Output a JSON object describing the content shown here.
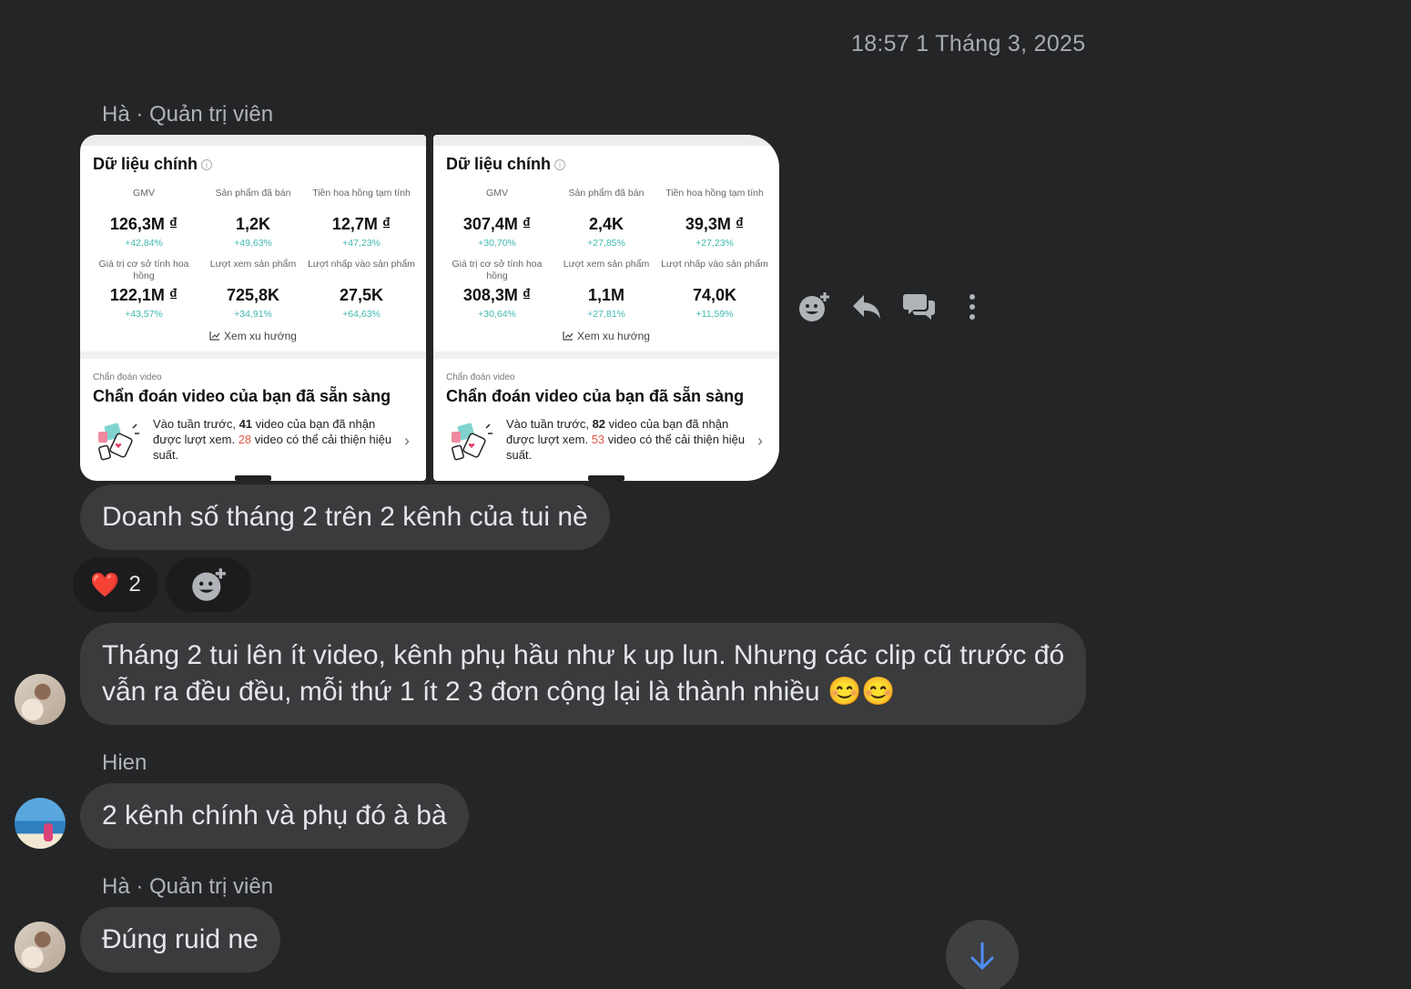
{
  "timestamp": "18:57 1 Tháng 3, 2025",
  "senders": {
    "ha_admin_1": "Hà · Quản trị viên",
    "hien": "Hien",
    "ha_admin_2": "Hà · Quản trị viên"
  },
  "cards": [
    {
      "title": "Dữ liệu chính",
      "metrics": [
        {
          "label": "GMV",
          "value": "126,3M ₫",
          "change": "+42,84%"
        },
        {
          "label": "Sản phẩm đã bán",
          "value": "1,2K",
          "change": "+49,63%"
        },
        {
          "label": "Tiền hoa hồng tạm tính",
          "value": "12,7M ₫",
          "change": "+47,23%"
        },
        {
          "label": "Giá trị cơ sở tính hoa hồng",
          "value": "122,1M ₫",
          "change": "+43,57%"
        },
        {
          "label": "Lượt xem sản phẩm",
          "value": "725,8K",
          "change": "+34,91%"
        },
        {
          "label": "Lượt nhấp vào sản phẩm",
          "value": "27,5K",
          "change": "+64,63%"
        }
      ],
      "trend_link": "Xem xu hướng",
      "diag_small": "Chẩn đoán video",
      "diag_title": "Chẩn đoán video của bạn đã sẵn sàng",
      "diag_text_1": "Vào tuần trước, ",
      "diag_count_views": "41",
      "diag_text_2": " video của bạn đã nhận được lượt xem. ",
      "diag_count_improve": "28",
      "diag_text_3": " video có thể cải thiện hiệu suất."
    },
    {
      "title": "Dữ liệu chính",
      "metrics": [
        {
          "label": "GMV",
          "value": "307,4M ₫",
          "change": "+30,70%"
        },
        {
          "label": "Sản phẩm đã bán",
          "value": "2,4K",
          "change": "+27,85%"
        },
        {
          "label": "Tiền hoa hồng tạm tính",
          "value": "39,3M ₫",
          "change": "+27,23%"
        },
        {
          "label": "Giá trị cơ sở tính hoa hồng",
          "value": "308,3M ₫",
          "change": "+30,64%"
        },
        {
          "label": "Lượt xem sản phẩm",
          "value": "1,1M",
          "change": "+27,81%"
        },
        {
          "label": "Lượt nhấp vào sản phẩm",
          "value": "74,0K",
          "change": "+11,59%"
        }
      ],
      "trend_link": "Xem xu hướng",
      "diag_small": "Chẩn đoán video",
      "diag_title": "Chẩn đoán video của bạn đã sẵn sàng",
      "diag_text_1": "Vào tuần trước, ",
      "diag_count_views": "82",
      "diag_text_2": " video của bạn đã nhận được lượt xem. ",
      "diag_count_improve": "53",
      "diag_text_3": " video có thể cải thiện hiệu suất."
    }
  ],
  "messages": {
    "m1": "Doanh số tháng 2 trên 2 kênh của tui nè",
    "m2_line1": "Tháng 2 tui lên ít video, kênh phụ hầu như k up lun. Nhưng các clip cũ trước đó",
    "m2_line2": "vẫn ra đều đều, mỗi thứ 1 ít 2 3 đơn cộng lại là thành nhiều 😊😊",
    "m3": "2 kênh chính và phụ đó à bà",
    "m4": "Đúng ruid ne"
  },
  "reaction": {
    "emoji": "❤️",
    "count": "2"
  },
  "icons": {
    "actions": [
      "add-reaction-icon",
      "reply-icon",
      "thread-icon",
      "more-icon"
    ],
    "scroll": "arrow-down-icon"
  },
  "colors": {
    "background": "#242526",
    "bubble": "#3a3b3c",
    "accent": "#4f8ef7",
    "change_positive": "#3fb8b0",
    "highlight_red": "#e05a47"
  }
}
